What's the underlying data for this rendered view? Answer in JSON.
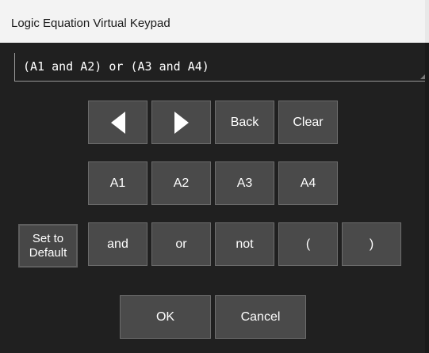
{
  "window": {
    "title": "Logic Equation Virtual Keypad"
  },
  "equation": {
    "value": "(A1 and A2) or (A3 and A4)"
  },
  "keypad": {
    "row1": {
      "left_icon": "left-triangle-icon",
      "right_icon": "right-triangle-icon",
      "back_label": "Back",
      "clear_label": "Clear"
    },
    "row2": {
      "a1_label": "A1",
      "a2_label": "A2",
      "a3_label": "A3",
      "a4_label": "A4"
    },
    "row3": {
      "default_label": "Set to\nDefault",
      "and_label": "and",
      "or_label": "or",
      "not_label": "not",
      "lparen_label": "(",
      "rparen_label": ")"
    }
  },
  "footer": {
    "ok_label": "OK",
    "cancel_label": "Cancel"
  },
  "colors": {
    "background": "#202020",
    "titlebar": "#f3f3f3",
    "key_face": "#4a4a4a",
    "key_border": "#6c6c6c",
    "text": "#ffffff"
  }
}
